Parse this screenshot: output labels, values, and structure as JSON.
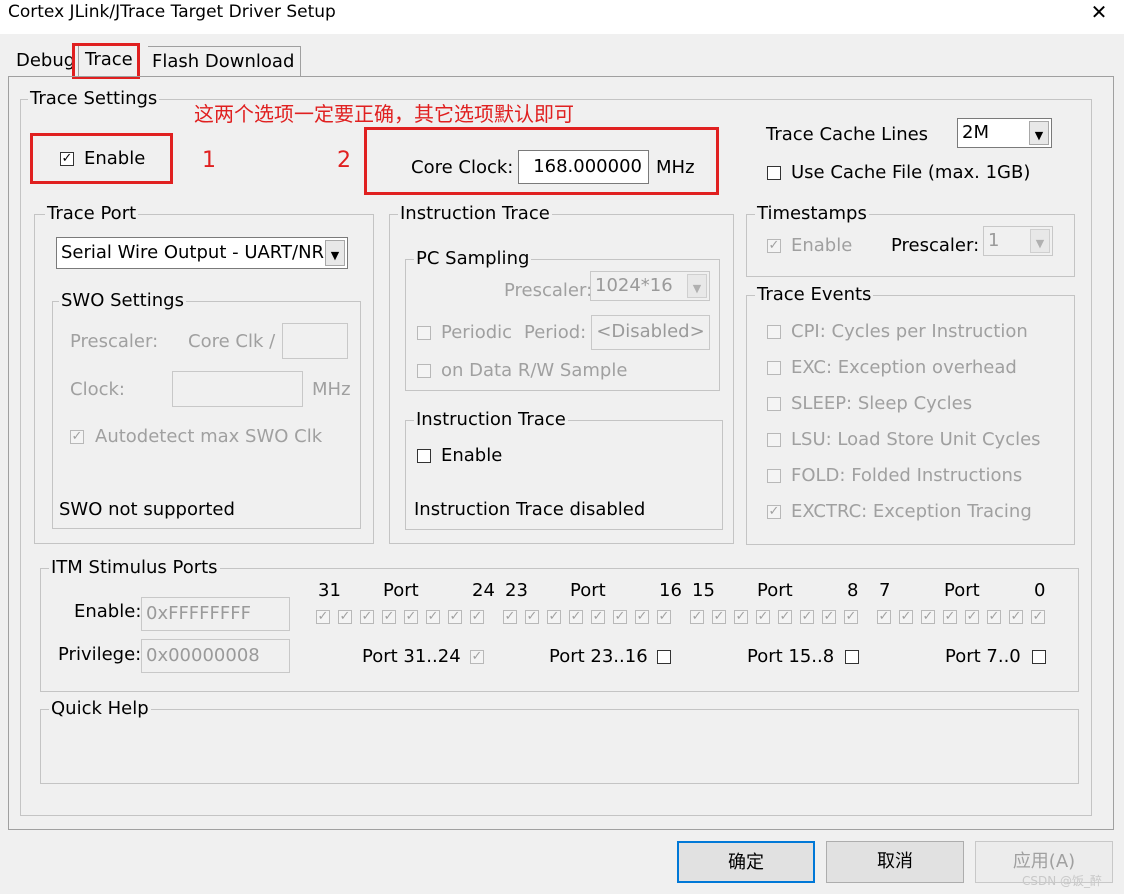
{
  "window": {
    "title": "Cortex JLink/JTrace Target Driver Setup",
    "close_glyph": "✕"
  },
  "tabs": [
    {
      "label": "Debug"
    },
    {
      "label": "Trace"
    },
    {
      "label": "Flash Download"
    }
  ],
  "annotation": {
    "note": "这两个选项一定要正确，其它选项默认即可",
    "marker1": "1",
    "marker2": "2",
    "color": "#e02020"
  },
  "trace_settings": {
    "title": "Trace Settings",
    "enable_label": "Enable",
    "enable_checked": "✓",
    "core_clock_label": "Core Clock:",
    "core_clock_value": "168.000000",
    "core_clock_unit": "MHz",
    "cache_lines_label": "Trace Cache Lines",
    "cache_lines_value": "2M",
    "use_cache_file_label": "Use Cache File (max. 1GB)"
  },
  "trace_port": {
    "title": "Trace Port",
    "port_value": "Serial Wire Output - UART/NR",
    "swo": {
      "title": "SWO Settings",
      "prescaler_label": "Prescaler:",
      "core_clk_label": "Core Clk /",
      "clock_label": "Clock:",
      "clock_unit": "MHz",
      "autodetect_label": "Autodetect max SWO Clk",
      "autodetect_checked": "✓",
      "status": "SWO not supported"
    }
  },
  "instruction_trace_group": {
    "title": "Instruction Trace",
    "pc_sampling": {
      "title": "PC Sampling",
      "prescaler_label": "Prescaler:",
      "prescaler_value": "1024*16",
      "periodic_label": "Periodic",
      "period_label": "Period:",
      "period_value": "<Disabled>",
      "data_rw_label": "on Data R/W Sample"
    },
    "inner": {
      "title": "Instruction Trace",
      "enable_label": "Enable",
      "status": "Instruction Trace disabled"
    }
  },
  "timestamps": {
    "title": "Timestamps",
    "enable_label": "Enable",
    "enable_checked": "✓",
    "prescaler_label": "Prescaler:",
    "prescaler_value": "1"
  },
  "trace_events": {
    "title": "Trace Events",
    "items": [
      {
        "label": "CPI: Cycles per Instruction",
        "mark": ""
      },
      {
        "label": "EXC: Exception overhead",
        "mark": ""
      },
      {
        "label": "SLEEP: Sleep Cycles",
        "mark": ""
      },
      {
        "label": "LSU: Load Store Unit Cycles",
        "mark": ""
      },
      {
        "label": "FOLD: Folded Instructions",
        "mark": ""
      },
      {
        "label": "EXCTRC: Exception Tracing",
        "mark": "✓"
      }
    ]
  },
  "itm": {
    "title": "ITM Stimulus Ports",
    "enable_label": "Enable:",
    "enable_value": "0xFFFFFFFF",
    "privilege_label": "Privilege:",
    "privilege_value": "0x00000008",
    "port_word": "Port",
    "groups": [
      {
        "hi": "31",
        "lo": "24",
        "priv_label": "Port 31..24",
        "priv_mark": "✓"
      },
      {
        "hi": "23",
        "lo": "16",
        "priv_label": "Port 23..16",
        "priv_mark": ""
      },
      {
        "hi": "15",
        "lo": "8",
        "priv_label": "Port 15..8",
        "priv_mark": ""
      },
      {
        "hi": "7",
        "lo": "0",
        "priv_label": "Port 7..0",
        "priv_mark": ""
      }
    ],
    "bit_mark": "✓"
  },
  "quick_help": {
    "title": "Quick Help"
  },
  "buttons": {
    "ok": "确定",
    "cancel": "取消",
    "apply": "应用(A)"
  },
  "watermark": "CSDN @饭_醉"
}
